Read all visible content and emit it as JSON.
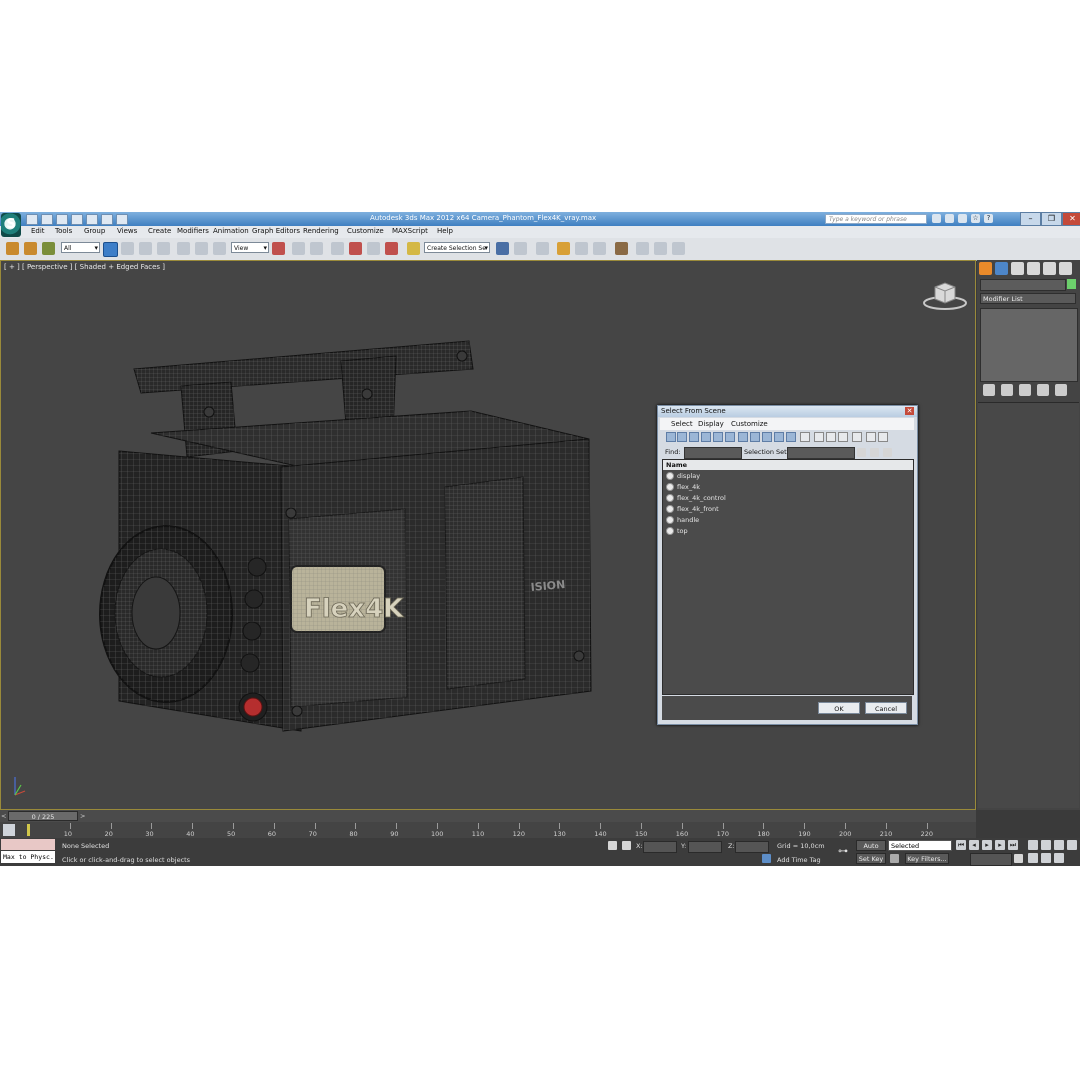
{
  "window": {
    "title": "Autodesk 3ds Max 2012 x64      Camera_Phantom_Flex4K_vray.max",
    "search_placeholder": "Type a keyword or phrase",
    "logo_letter": "S"
  },
  "menu": [
    "Edit",
    "Tools",
    "Group",
    "Views",
    "Create",
    "Modifiers",
    "Animation",
    "Graph Editors",
    "Rendering",
    "Customize",
    "MAXScript",
    "Help"
  ],
  "toolbar": {
    "filter_value": "All",
    "refcoord_value": "View",
    "named_selection_value": "Create Selection Se"
  },
  "viewport": {
    "label": "[ + ] [ Perspective ] [ Shaded + Edged Faces ]",
    "model_display_text": "Flex4K",
    "model_brand_text": "ISION"
  },
  "dialog": {
    "title": "Select From Scene",
    "menu": [
      "Select",
      "Display",
      "Customize"
    ],
    "find_label": "Find:",
    "selection_set_label": "Selection Set:",
    "column_header": "Name",
    "items": [
      "display",
      "flex_4k",
      "flex_4k_control",
      "flex_4k_front",
      "handle",
      "top"
    ],
    "ok_label": "OK",
    "cancel_label": "Cancel"
  },
  "command_panel": {
    "modifier_list": "Modifier List",
    "object_color": "#6ccf6c"
  },
  "timeline": {
    "frame_readout": "0 / 225",
    "ticks": [
      10,
      20,
      30,
      40,
      50,
      60,
      70,
      80,
      90,
      100,
      110,
      120,
      130,
      140,
      150,
      160,
      170,
      180,
      190,
      200,
      210,
      220
    ]
  },
  "status": {
    "script_listener": "Max to Physc.",
    "selection": "None Selected",
    "prompt": "Click or click-and-drag to select objects",
    "x_label": "X:",
    "y_label": "Y:",
    "z_label": "Z:",
    "grid": "Grid = 10,0cm",
    "add_time_tag": "Add Time Tag",
    "auto_key": "Auto Key",
    "set_key": "Set Key",
    "key_mode_value": "Selected",
    "key_filters": "Key Filters..."
  }
}
